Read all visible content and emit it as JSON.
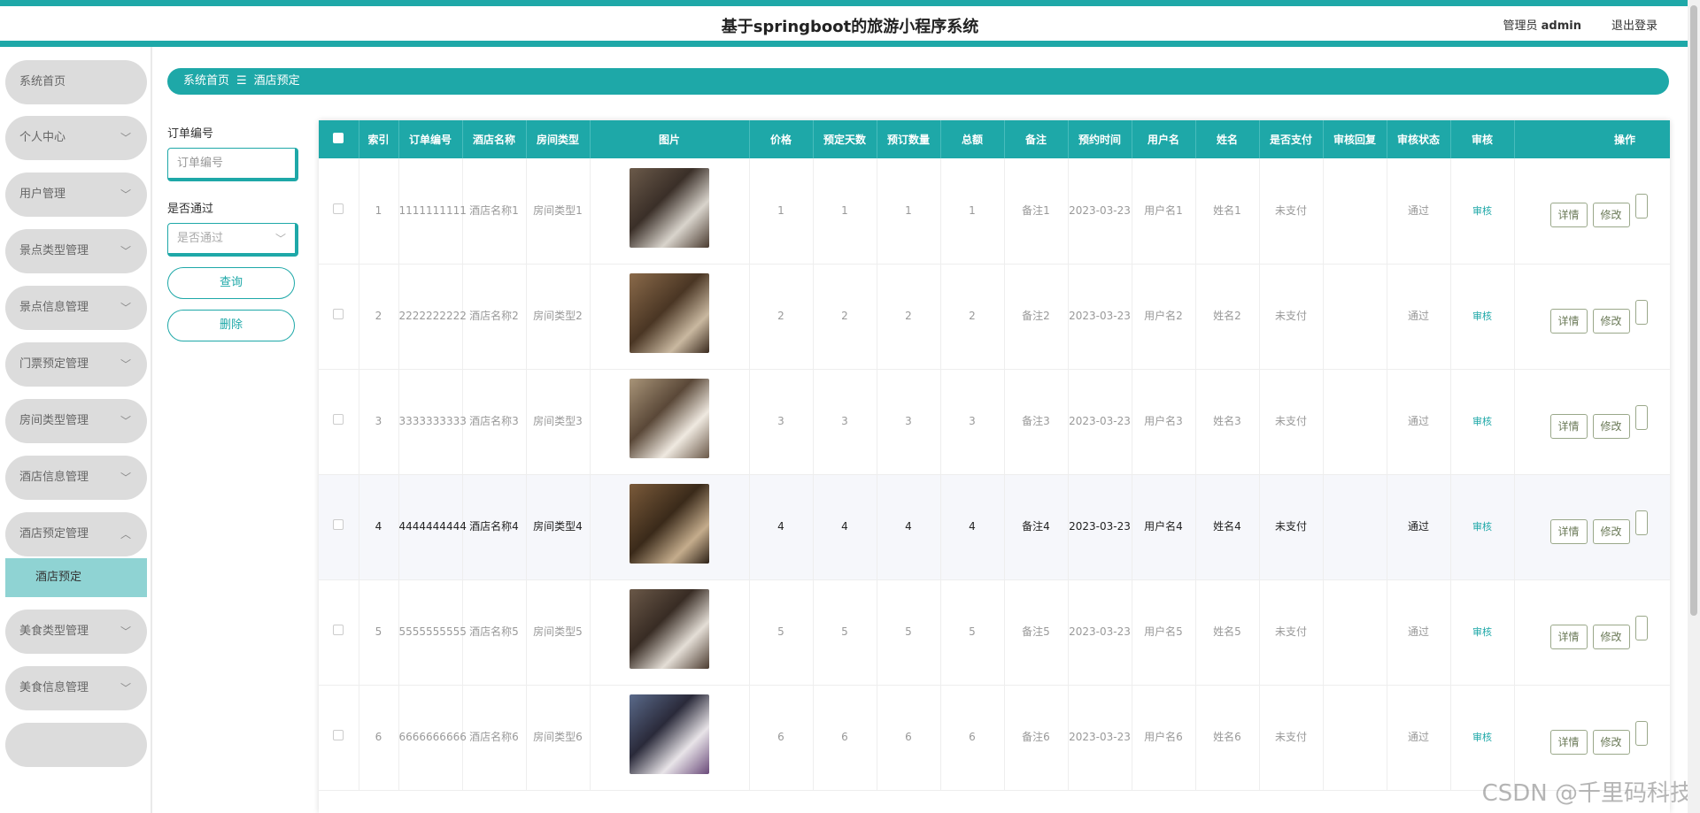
{
  "header": {
    "title": "基于springboot的旅游小程序系统",
    "admin_label": "管理员",
    "admin_name": "admin",
    "logout": "退出登录"
  },
  "sidebar": {
    "items": [
      {
        "label": "系统首页",
        "chevron": ""
      },
      {
        "label": "个人中心",
        "chevron": "﹀"
      },
      {
        "label": "用户管理",
        "chevron": "﹀"
      },
      {
        "label": "景点类型管理",
        "chevron": "﹀"
      },
      {
        "label": "景点信息管理",
        "chevron": "﹀"
      },
      {
        "label": "门票预定管理",
        "chevron": "﹀"
      },
      {
        "label": "房间类型管理",
        "chevron": "﹀"
      },
      {
        "label": "酒店信息管理",
        "chevron": "﹀"
      },
      {
        "label": "酒店预定管理",
        "chevron": "︿"
      },
      {
        "label": "美食类型管理",
        "chevron": "﹀"
      },
      {
        "label": "美食信息管理",
        "chevron": "﹀"
      }
    ],
    "subitem": "酒店预定"
  },
  "breadcrumb": {
    "home": "系统首页",
    "sep": "☰",
    "current": "酒店预定"
  },
  "search": {
    "order_label": "订单编号",
    "order_placeholder": "订单编号",
    "pass_label": "是否通过",
    "pass_placeholder": "是否通过",
    "query_btn": "查询",
    "delete_btn": "删除"
  },
  "table": {
    "headers": [
      "",
      "索引",
      "订单编号",
      "酒店名称",
      "房间类型",
      "图片",
      "价格",
      "预定天数",
      "预订数量",
      "总额",
      "备注",
      "预约时间",
      "用户名",
      "姓名",
      "是否支付",
      "审核回复",
      "审核状态",
      "审核",
      "操作"
    ],
    "rows": [
      {
        "index": "1",
        "order": "1111111111",
        "hotel": "酒店名称1",
        "room": "房间类型1",
        "price": "1",
        "days": "1",
        "qty": "1",
        "total": "1",
        "note": "备注1",
        "time": "2023-03-23",
        "user": "用户名1",
        "name": "姓名1",
        "paid": "未支付",
        "reply": "",
        "status": "通过",
        "audit": "审核"
      },
      {
        "index": "2",
        "order": "2222222222",
        "hotel": "酒店名称2",
        "room": "房间类型2",
        "price": "2",
        "days": "2",
        "qty": "2",
        "total": "2",
        "note": "备注2",
        "time": "2023-03-23",
        "user": "用户名2",
        "name": "姓名2",
        "paid": "未支付",
        "reply": "",
        "status": "通过",
        "audit": "审核"
      },
      {
        "index": "3",
        "order": "3333333333",
        "hotel": "酒店名称3",
        "room": "房间类型3",
        "price": "3",
        "days": "3",
        "qty": "3",
        "total": "3",
        "note": "备注3",
        "time": "2023-03-23",
        "user": "用户名3",
        "name": "姓名3",
        "paid": "未支付",
        "reply": "",
        "status": "通过",
        "audit": "审核"
      },
      {
        "index": "4",
        "order": "4444444444",
        "hotel": "酒店名称4",
        "room": "房间类型4",
        "price": "4",
        "days": "4",
        "qty": "4",
        "total": "4",
        "note": "备注4",
        "time": "2023-03-23",
        "user": "用户名4",
        "name": "姓名4",
        "paid": "未支付",
        "reply": "",
        "status": "通过",
        "audit": "审核"
      },
      {
        "index": "5",
        "order": "5555555555",
        "hotel": "酒店名称5",
        "room": "房间类型5",
        "price": "5",
        "days": "5",
        "qty": "5",
        "total": "5",
        "note": "备注5",
        "time": "2023-03-23",
        "user": "用户名5",
        "name": "姓名5",
        "paid": "未支付",
        "reply": "",
        "status": "通过",
        "audit": "审核"
      },
      {
        "index": "6",
        "order": "6666666666",
        "hotel": "酒店名称6",
        "room": "房间类型6",
        "price": "6",
        "days": "6",
        "qty": "6",
        "total": "6",
        "note": "备注6",
        "time": "2023-03-23",
        "user": "用户名6",
        "name": "姓名6",
        "paid": "未支付",
        "reply": "",
        "status": "通过",
        "audit": "审核"
      }
    ],
    "ops": {
      "detail": "详情",
      "edit": "修改"
    }
  },
  "watermark": "CSDN @千里码科技",
  "colors": {
    "accent": "#1ea8a8",
    "sub_active": "#8fd3d3",
    "menu_bg": "#dcdcdc"
  }
}
